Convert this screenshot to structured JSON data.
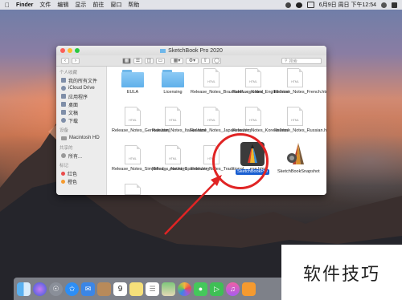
{
  "menubar": {
    "app": "Finder",
    "items": [
      "文件",
      "编辑",
      "显示",
      "前往",
      "窗口",
      "帮助"
    ],
    "datetime": "6月9日 周日 下午12:54"
  },
  "window": {
    "title": "SketchBook Pro 2020",
    "search_placeholder": "搜索"
  },
  "sidebar": {
    "favorites_header": "个人收藏",
    "favorites": [
      "我的所有文件",
      "iCloud Drive",
      "应用程序",
      "桌面",
      "文稿",
      "下载"
    ],
    "devices_header": "设备",
    "devices": [
      "Macintosh HD"
    ],
    "shared_header": "共享的",
    "shared": [
      "所有..."
    ],
    "tags_header": "标记",
    "tags": [
      {
        "label": "红色",
        "color": "#e94b4b"
      },
      {
        "label": "橙色",
        "color": "#f59a2f"
      }
    ]
  },
  "files": [
    {
      "name": "EULA",
      "kind": "folder"
    },
    {
      "name": "Licensing",
      "kind": "folder"
    },
    {
      "name": "Release_Notes_BrazilianP...ese.html",
      "kind": "html"
    },
    {
      "name": "Release_Notes_English.html",
      "kind": "html"
    },
    {
      "name": "Release_Notes_French.html",
      "kind": "html"
    },
    {
      "name": "Release_Notes_German.html",
      "kind": "html"
    },
    {
      "name": "Release_Notes_Italian.html",
      "kind": "html"
    },
    {
      "name": "Release_Notes_Japanese.html",
      "kind": "html"
    },
    {
      "name": "Release_Notes_Korean.html",
      "kind": "html"
    },
    {
      "name": "Release_Notes_Russian.html",
      "kind": "html"
    },
    {
      "name": "Release_Notes_Simplified_...ese.html",
      "kind": "html"
    },
    {
      "name": "Release_Notes_Spanish.html",
      "kind": "html"
    },
    {
      "name": "Release_Notes_Traditional_...ese.html",
      "kind": "html"
    },
    {
      "name": "SketchBookPro",
      "kind": "app",
      "selected": true
    },
    {
      "name": "SketchBookSnapshot",
      "kind": "app"
    }
  ],
  "doc_badge": "HTML",
  "watermark": "软件技巧",
  "dock_icons": [
    "finder-icon",
    "siri-icon",
    "launchpad-icon",
    "safari-icon",
    "mail-icon",
    "contacts-icon",
    "calendar-icon",
    "notes-icon",
    "reminders-icon",
    "maps-icon",
    "photos-icon",
    "messages-icon",
    "facetime-icon",
    "itunes-icon",
    "books-icon"
  ],
  "calendar_day": "9"
}
